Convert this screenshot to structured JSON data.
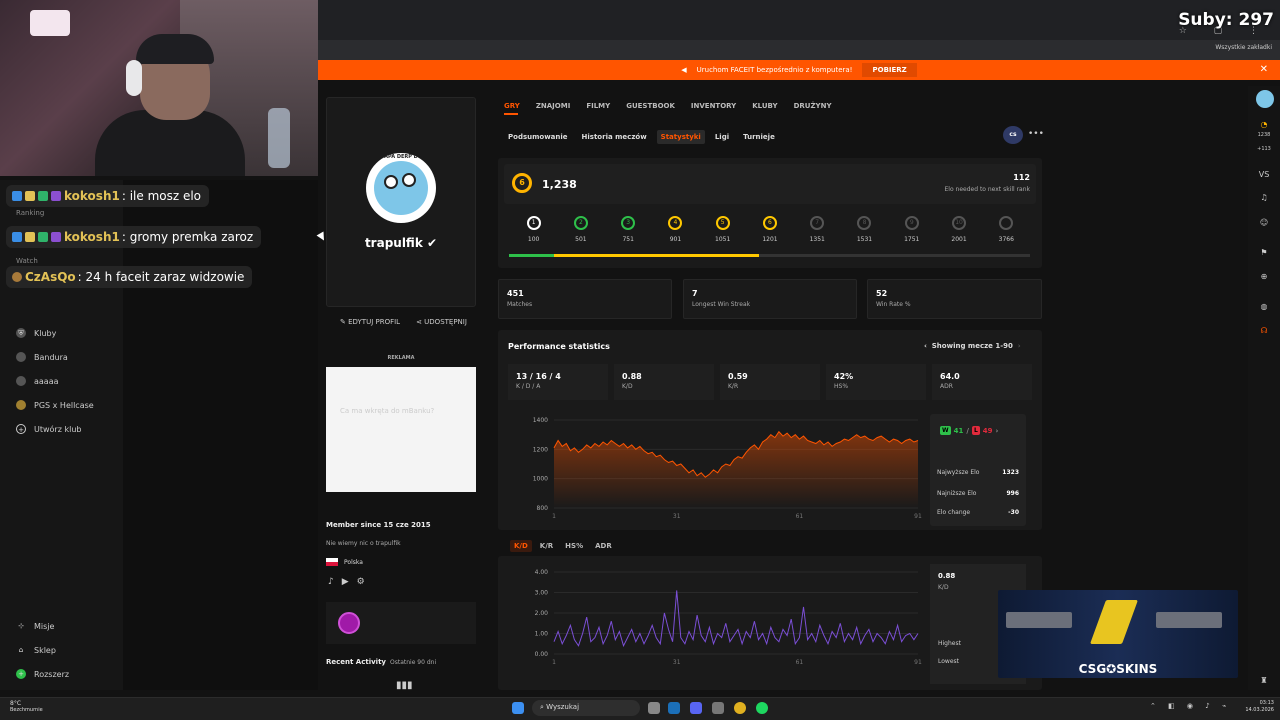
{
  "stream_overlay": {
    "subs_counter": "Suby: 297",
    "chat": [
      {
        "user": "kokosh1",
        "message": ": ile mosz elo",
        "color": "#e3c256"
      },
      {
        "user": "kokosh1",
        "message": ": gromy premka zaroz",
        "color": "#e3c256"
      },
      {
        "user": "CzAsQo",
        "message": ": 24 h faceit zaraz widzowie",
        "color": "#e3c256"
      }
    ],
    "faded_nav": [
      "Ranking",
      "Watch"
    ]
  },
  "browser": {
    "bookmarks_label": "Wszystkie zakładki"
  },
  "banner": {
    "text": "Uruchom FACEIT bezpośrednio z komputera!",
    "button": "POBIERZ",
    "close": "✕"
  },
  "sidebar": {
    "items": [
      {
        "label": "Kluby",
        "icon": "shield-icon"
      },
      {
        "label": "Bandura",
        "icon": "club-avatar-icon"
      },
      {
        "label": "aaaaa",
        "icon": "club-avatar-icon"
      },
      {
        "label": "PGS x Hellcase",
        "icon": "club-avatar-icon"
      },
      {
        "label": "Utwórz klub",
        "icon": "plus-circle-icon"
      }
    ],
    "bottom_items": [
      {
        "label": "Misje",
        "icon": "target-icon"
      },
      {
        "label": "Sklep",
        "icon": "cart-icon"
      },
      {
        "label": "Rozszerz",
        "icon": "expand-icon"
      }
    ]
  },
  "profile": {
    "avatar_caption": "APA DERP D",
    "nickname": "trapulfik",
    "edit_label": "EDYTUJ PROFIL",
    "share_label": "UDOSTĘPNIJ",
    "ad_label": "REKLAMA",
    "ad_text": "Ca ma wkręta do mBanku?",
    "member_since": "Member since 15 cze 2015",
    "about": "Nie wiemy nic o trapulfik",
    "country": "Polska",
    "recent_activity": "Recent Activity",
    "recent_range": "Ostatnie 90 dni"
  },
  "tabs": {
    "main": [
      "GRY",
      "ZNAJOMI",
      "FILMY",
      "GUESTBOOK",
      "INVENTORY",
      "KLUBY",
      "DRUŻYNY"
    ],
    "sub": [
      "Podsumowanie",
      "Historia meczów",
      "Statystyki",
      "Ligi",
      "Turnieje"
    ],
    "game_badge": "cs"
  },
  "elo": {
    "level": "6",
    "value": "1,238",
    "to_next": "112",
    "to_next_label": "Elo needed to next skill rank",
    "levels": [
      {
        "n": "1",
        "elo": "100",
        "color": "#ffffff"
      },
      {
        "n": "2",
        "elo": "501",
        "color": "#2ec04a"
      },
      {
        "n": "3",
        "elo": "751",
        "color": "#2ec04a"
      },
      {
        "n": "4",
        "elo": "901",
        "color": "#ffc800"
      },
      {
        "n": "5",
        "elo": "1051",
        "color": "#ffc800"
      },
      {
        "n": "6",
        "elo": "1201",
        "color": "#ffc800"
      },
      {
        "n": "7",
        "elo": "1351",
        "color": "#555555"
      },
      {
        "n": "8",
        "elo": "1531",
        "color": "#555555"
      },
      {
        "n": "9",
        "elo": "1751",
        "color": "#555555"
      },
      {
        "n": "10",
        "elo": "2001",
        "color": "#555555"
      },
      {
        "n": "",
        "elo": "3766",
        "color": "#555555"
      }
    ],
    "progress_fraction": 0.48
  },
  "summary_stats": [
    {
      "value": "451",
      "label": "Matches"
    },
    {
      "value": "7",
      "label": "Longest Win Streak"
    },
    {
      "value": "52",
      "label": "Win Rate %"
    }
  ],
  "performance": {
    "title": "Performance statistics",
    "showing": "Showing mecze 1-90",
    "cards": [
      {
        "value": "13 / 16 / 4",
        "label": "K / D / A"
      },
      {
        "value": "0.88",
        "label": "K/D"
      },
      {
        "value": "0.59",
        "label": "K/R"
      },
      {
        "value": "42%",
        "label": "HS%"
      },
      {
        "value": "64.0",
        "label": "ADR"
      }
    ],
    "wins": "41",
    "losses": "49",
    "highest_label": "Najwyższe Elo",
    "highest": "1323",
    "lowest_label": "Najniższe Elo",
    "lowest": "996",
    "change_label": "Elo change",
    "change": "-30",
    "metric_tabs": [
      "K/D",
      "K/R",
      "HS%",
      "ADR"
    ],
    "kd_value": "0.88",
    "kd_label": "K/D",
    "highest_short": "Highest",
    "lowest_short": "Lowest"
  },
  "chart_data": [
    {
      "type": "area",
      "title": "",
      "ylim": [
        800,
        1400
      ],
      "yticks": [
        "1400",
        "1200",
        "1000",
        "800"
      ],
      "xticks": [
        "1",
        "31",
        "61",
        "91"
      ],
      "color": "#ff5500",
      "series": [
        {
          "values": [
            1210,
            1260,
            1220,
            1240,
            1190,
            1210,
            1180,
            1200,
            1230,
            1210,
            1240,
            1220,
            1250,
            1230,
            1260,
            1240,
            1220,
            1240,
            1210,
            1230,
            1200,
            1220,
            1190,
            1170,
            1180,
            1150,
            1160,
            1130,
            1110,
            1120,
            1090,
            1100,
            1070,
            1040,
            1060,
            1020,
            1040,
            1010,
            1030,
            1060,
            1040,
            1080,
            1100,
            1090,
            1130,
            1150,
            1140,
            1180,
            1210,
            1230,
            1200,
            1250,
            1270,
            1300,
            1280,
            1320,
            1290,
            1310,
            1280,
            1300,
            1270,
            1290,
            1260,
            1250,
            1240,
            1260,
            1230,
            1250,
            1220,
            1240,
            1250,
            1270,
            1260,
            1280,
            1300,
            1280,
            1290,
            1270,
            1260,
            1280,
            1290,
            1270,
            1250,
            1270,
            1260,
            1240,
            1260,
            1270,
            1250,
            1260
          ]
        }
      ]
    },
    {
      "type": "line",
      "title": "",
      "ylim": [
        0,
        4
      ],
      "yticks": [
        "4.00",
        "3.00",
        "2.00",
        "1.00",
        "0.00"
      ],
      "xticks": [
        "1",
        "31",
        "61",
        "91"
      ],
      "color": "#7b4fd6",
      "series": [
        {
          "values": [
            0.6,
            1.1,
            0.5,
            0.9,
            1.4,
            0.7,
            0.4,
            1.0,
            1.8,
            0.6,
            0.8,
            1.3,
            0.5,
            0.9,
            1.6,
            0.7,
            1.1,
            0.4,
            0.8,
            1.2,
            0.6,
            1.0,
            0.5,
            0.9,
            1.4,
            0.8,
            0.5,
            2.0,
            1.2,
            0.6,
            3.1,
            0.8,
            0.5,
            1.1,
            0.7,
            1.9,
            0.9,
            0.6,
            1.3,
            0.5,
            1.0,
            0.8,
            1.5,
            0.6,
            0.9,
            1.2,
            0.5,
            1.1,
            0.8,
            1.6,
            0.7,
            1.0,
            0.5,
            1.3,
            0.8,
            0.6,
            1.2,
            0.9,
            1.7,
            0.5,
            0.8,
            2.3,
            0.7,
            1.0,
            0.6,
            1.4,
            0.9,
            0.5,
            1.1,
            0.8,
            1.5,
            0.6,
            1.0,
            0.7,
            1.3,
            0.5,
            0.9,
            1.2,
            0.6,
            1.0,
            0.8,
            0.5,
            1.1,
            0.7,
            1.4,
            0.6,
            0.9,
            1.0,
            0.7,
            1.0
          ]
        }
      ]
    }
  ],
  "skins_ad": {
    "brand": "CSG✪SKINS"
  },
  "taskbar": {
    "weather_temp": "8°C",
    "weather_desc": "Bezchmurnie",
    "search": "Wyszukaj",
    "time": "03:13",
    "date": "14.03.2026"
  }
}
